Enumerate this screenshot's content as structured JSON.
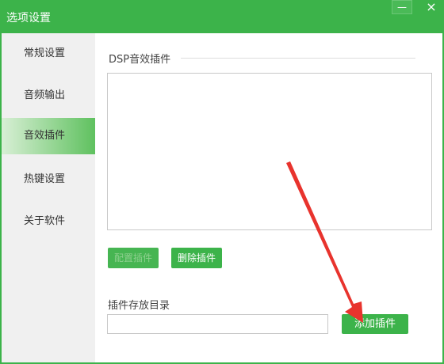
{
  "window": {
    "title": "选项设置",
    "minimize_glyph": "—",
    "maximize_glyph": "▢",
    "close_glyph": "×"
  },
  "sidebar": {
    "items": [
      {
        "label": "常规设置",
        "active": false
      },
      {
        "label": "音频输出",
        "active": false
      },
      {
        "label": "音效插件",
        "active": true
      },
      {
        "label": "热键设置",
        "active": false
      },
      {
        "label": "关于软件",
        "active": false
      }
    ]
  },
  "content": {
    "section_title": "DSP音效插件",
    "config_button": "配置插件",
    "delete_button": "删除插件",
    "dir_label": "插件存放目录",
    "dir_value": "",
    "add_button": "添加插件"
  },
  "colors": {
    "brand": "#3cb34a",
    "annotation_arrow": "#e8332d"
  }
}
